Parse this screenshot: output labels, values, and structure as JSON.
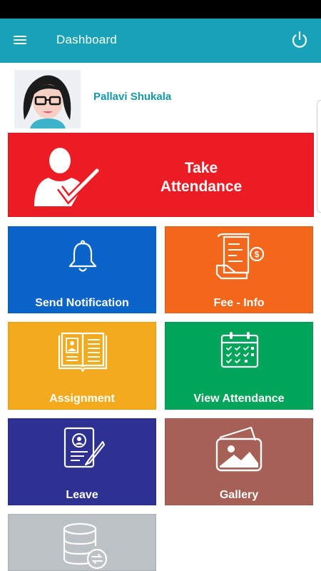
{
  "appbar": {
    "title": "Dashboard",
    "menu_icon": "menu-icon",
    "power_icon": "power-icon"
  },
  "profile": {
    "name": "Pallavi Shukala",
    "avatar_icon": "avatar-icon"
  },
  "tiles": {
    "take_attendance": {
      "line1": "Take",
      "line2": "Attendance",
      "color": "#ec1c24",
      "icon": "attendance-check-icon"
    },
    "send_notification": {
      "label": "Send Notification",
      "color": "#0a63c9",
      "icon": "bell-icon"
    },
    "fee_info": {
      "label": "Fee - Info",
      "color": "#f4671b",
      "icon": "fee-receipt-icon"
    },
    "assignment": {
      "label": "Assignment",
      "color": "#f3ab1d",
      "icon": "open-book-icon"
    },
    "view_attendance": {
      "label": "View Attendance",
      "color": "#00a45a",
      "icon": "calendar-icon"
    },
    "leave": {
      "label": "Leave",
      "color": "#2e3192",
      "icon": "leave-document-icon"
    },
    "gallery": {
      "label": "Gallery",
      "color": "#a66056",
      "icon": "gallery-icon"
    },
    "backup": {
      "label": "",
      "color": "#bcc1c5",
      "icon": "database-sync-icon"
    }
  }
}
